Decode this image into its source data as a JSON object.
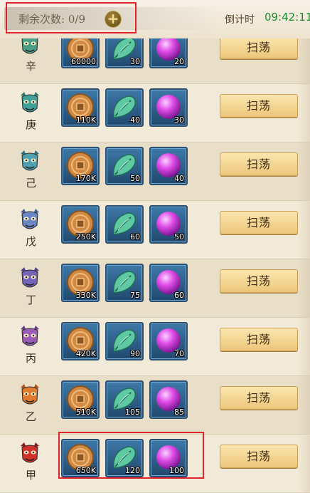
{
  "header": {
    "remaining_label": "剩余次数",
    "remaining_value": "0/9",
    "timer_label": "倒计时",
    "timer_value": "09:42:11"
  },
  "sweep_label": "扫荡",
  "stages": [
    {
      "stem": "辛",
      "coin": "60000",
      "leaf": "30",
      "orb": "20",
      "mask": "#4b9e86",
      "horn": "#3a7d6b"
    },
    {
      "stem": "庚",
      "coin": "110K",
      "leaf": "40",
      "orb": "30",
      "mask": "#3fa09a",
      "horn": "#2f7e78"
    },
    {
      "stem": "己",
      "coin": "170K",
      "leaf": "50",
      "orb": "40",
      "mask": "#4fa0b0",
      "horn": "#2d7487"
    },
    {
      "stem": "戊",
      "coin": "250K",
      "leaf": "60",
      "orb": "50",
      "mask": "#6a86c4",
      "horn": "#4b5f9a"
    },
    {
      "stem": "丁",
      "coin": "330K",
      "leaf": "75",
      "orb": "60",
      "mask": "#7565b8",
      "horn": "#52428c"
    },
    {
      "stem": "丙",
      "coin": "420K",
      "leaf": "90",
      "orb": "70",
      "mask": "#9a5cb5",
      "horn": "#6e3c89"
    },
    {
      "stem": "乙",
      "coin": "510K",
      "leaf": "105",
      "orb": "85",
      "mask": "#e07a30",
      "horn": "#b35219"
    },
    {
      "stem": "甲",
      "coin": "650K",
      "leaf": "120",
      "orb": "100",
      "mask": "#d0312a",
      "horn": "#8e1b17"
    }
  ]
}
